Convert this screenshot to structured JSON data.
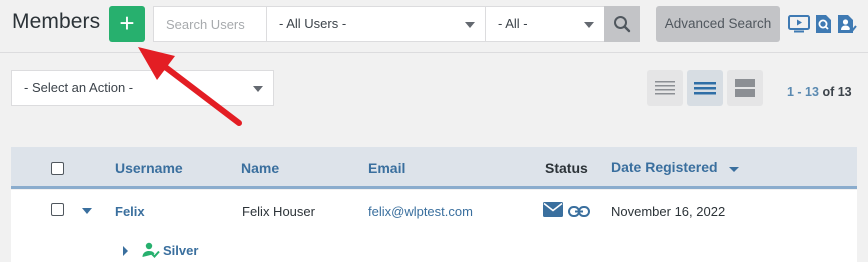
{
  "header": {
    "title": "Members",
    "add_label": "+",
    "search_placeholder": "Search Users",
    "users_filter": "- All Users -",
    "status_filter": "- All -",
    "advanced_search": "Advanced Search",
    "icons": [
      "video-icon",
      "search-doc-icon",
      "user-doc-icon"
    ]
  },
  "actions": {
    "select_placeholder": "- Select an Action -",
    "views": [
      "list-compact-icon",
      "list-default-icon",
      "list-wide-icon"
    ],
    "pager": {
      "range": "1 - 13",
      "total": "of 13"
    }
  },
  "table": {
    "columns": [
      "Username",
      "Name",
      "Email",
      "Status",
      "Date Registered"
    ],
    "rows": [
      {
        "username": "Felix",
        "name": "Felix Houser",
        "email": "felix@wlptest.com",
        "date": "November 16, 2022",
        "level": "Silver"
      }
    ]
  },
  "colors": {
    "accent_green": "#27b06e",
    "link_blue": "#3a6f9e",
    "annotation_arrow": "#e31e24"
  }
}
